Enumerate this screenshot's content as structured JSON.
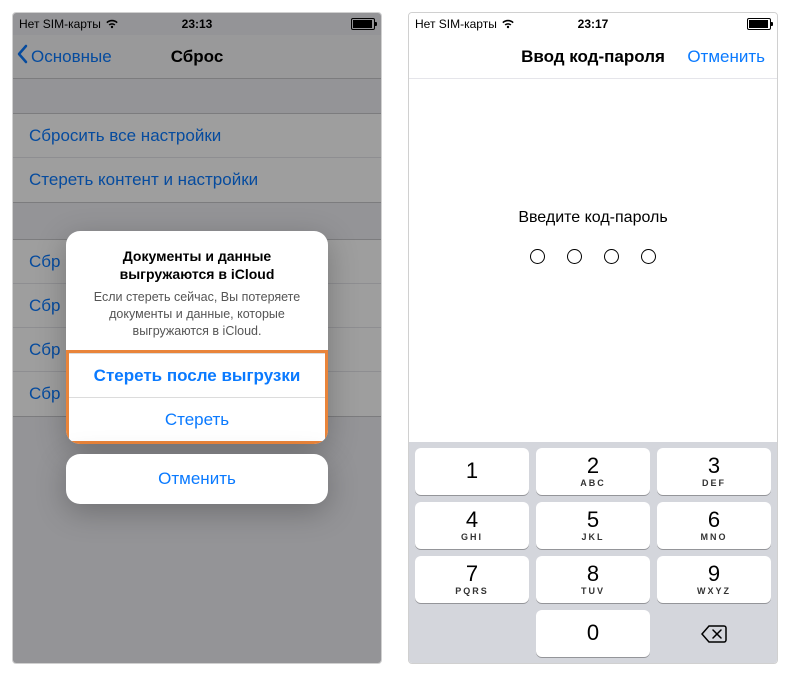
{
  "left": {
    "status": {
      "carrier": "Нет SIM-карты",
      "time": "23:13"
    },
    "nav": {
      "back": "Основные",
      "title": "Сброс"
    },
    "rows": [
      "Сбросить все настройки",
      "Стереть контент и настройки"
    ],
    "rows2": [
      "Сбросить настройки сети",
      "Сбросить словарь клавиатуры",
      "Сбросить настройки «Домой»",
      "Сбросить геонастройки"
    ],
    "rows2_short": [
      "Сбр",
      "Сбр",
      "Сбр",
      "Сбр"
    ],
    "alert": {
      "title_l1": "Документы и данные",
      "title_l2": "выгружаются в iCloud",
      "message": "Если стереть сейчас, Вы потеряете документы и данные, которые выгружаются в iCloud.",
      "after_upload": "Стереть после выгрузки",
      "erase": "Стереть",
      "cancel": "Отменить"
    }
  },
  "right": {
    "status": {
      "carrier": "Нет SIM-карты",
      "time": "23:17"
    },
    "nav": {
      "title": "Ввод код-пароля",
      "cancel": "Отменить"
    },
    "prompt": "Введите код-пароль",
    "keypad": [
      {
        "d": "1",
        "l": ""
      },
      {
        "d": "2",
        "l": "ABC"
      },
      {
        "d": "3",
        "l": "DEF"
      },
      {
        "d": "4",
        "l": "GHI"
      },
      {
        "d": "5",
        "l": "JKL"
      },
      {
        "d": "6",
        "l": "MNO"
      },
      {
        "d": "7",
        "l": "PQRS"
      },
      {
        "d": "8",
        "l": "TUV"
      },
      {
        "d": "9",
        "l": "WXYZ"
      }
    ],
    "zero": {
      "d": "0",
      "l": ""
    }
  }
}
